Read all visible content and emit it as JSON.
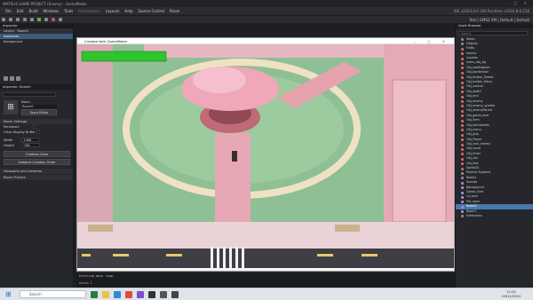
{
  "window": {
    "title": "WATSLIS GAME PROJECT (Enemy) - GameMaker",
    "controls": "– ▢ ✕"
  },
  "menu": {
    "items": [
      "File",
      "Edit",
      "Build",
      "Windows",
      "Tools",
      "Marketplace",
      "Layouts",
      "Help",
      "Source Control",
      "Room"
    ],
    "info": "IDE v2024.8.0.169  Runtime v2024.8.0.216"
  },
  "toolbar": {
    "status": "Test | GMS2 VM | Default | Default"
  },
  "left_panel": {
    "inspector_tab": "Inspector",
    "layers_title": "Layers · Room0",
    "layers": [
      "Instances",
      "Background"
    ],
    "inspector2_tab": "Inspector: Room0",
    "search_placeholder": "Search",
    "room_label": "Room",
    "room_name": "Room0",
    "open_editor": "Open Editor",
    "room_settings": "Room Settings",
    "persistent": "Persistent",
    "clear_display": "Clear Display Buffer",
    "width_label": "Width",
    "width_value": "1366",
    "height_label": "Height",
    "height_value": "768",
    "creation_code": "Creation Code",
    "instance_order": "Instance Creation Order",
    "viewports": "Viewports and Cameras",
    "physics": "Room Physics"
  },
  "right_panel": {
    "tab": "Asset Browser",
    "search_placeholder": "Search",
    "sections": [
      "Notes",
      "Objects"
    ],
    "objects": [
      "Flafts",
      "enemy",
      "nosoles",
      "menu_obj_bg",
      "Obj_loadingbars",
      "Obj_borderwall",
      "Obj_Button_Parent",
      "Obj_button_Menu",
      "Obj_control",
      "Obj_death",
      "Obj_end",
      "Obj_enemy",
      "Obj_enemy_system",
      "Obj_enemyParent",
      "Obj_game_over",
      "Obj_item",
      "Obj_Itembullets",
      "Obj_menu",
      "Obj_play",
      "Obj_Player",
      "Obj_rock_enemy",
      "Obj_score",
      "Obj_timer",
      "Obj_ves",
      "Obj_test",
      "Sprite24"
    ],
    "particle": "Particle Systems",
    "rooms_folder": "Rooms",
    "rooms": [
      "Sounds",
      "Background",
      "Game_Over",
      "Lvl_end",
      "Pre_room",
      "Room0",
      "Room1"
    ],
    "selected_room": "Room0",
    "footer": "Extensions"
  },
  "game_window": {
    "title": "Created with GameMaker",
    "health_bar": 1.0,
    "colors": {
      "health": "#2ec52e",
      "ground": "#e9c7c6",
      "grass": "#8fbf95",
      "road": "#3e3e44"
    }
  },
  "output": {
    "lines": [
      "Entering main loop.",
      "",
      "alarm 1"
    ]
  },
  "taskbar": {
    "search_placeholder": "Search",
    "time": "11:02",
    "date": "09/11/2024"
  }
}
